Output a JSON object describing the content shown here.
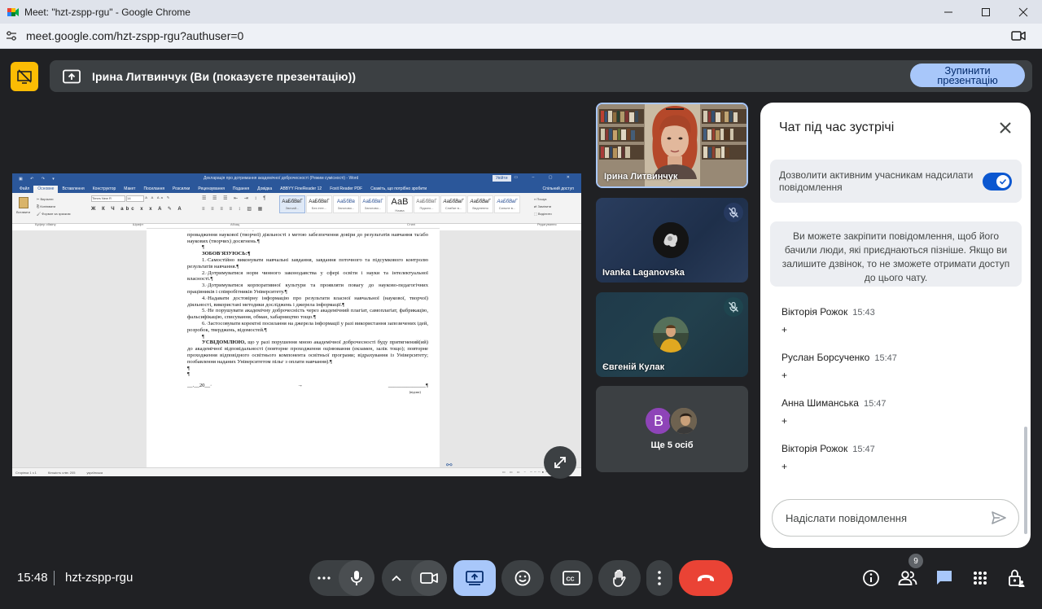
{
  "browser": {
    "window_title": "Meet: \"hzt-zspp-rgu\" - Google Chrome",
    "url": "meet.google.com/hzt-zspp-rgu?authuser=0"
  },
  "presenting": {
    "banner_text": "Ірина Литвинчук (Ви (показуєте презентацію))",
    "stop_button_label": "Зупинити презентацію"
  },
  "word": {
    "doc_title": "Декларація про дотримання академічної доброчесності (Режим сумісності) - Word",
    "sign_in": "Увійти",
    "tabs": [
      "Файл",
      "Основне",
      "Вставлення",
      "Конструктор",
      "Макет",
      "Посилання",
      "Розсилки",
      "Рецензування",
      "Подання",
      "Довідка",
      "ABBYY FineReader 12",
      "Foxit Reader PDF",
      "Скажіть, що потрібно зробити",
      "Спільний доступ"
    ],
    "active_tab": "Основне",
    "clipboard": {
      "paste": "Вставити",
      "cut": "Вирізати",
      "copy": "Копіювати",
      "format": "Формат за зразком"
    },
    "font_name": "Times New R",
    "font_size": "14",
    "styles": [
      {
        "sample": "АаБбВвГ",
        "name": "Звичай..."
      },
      {
        "sample": "АаБбВвГ",
        "name": "Без інте..."
      },
      {
        "sample": "АаБбВв",
        "name": "Заголово..."
      },
      {
        "sample": "АаБбВвГ",
        "name": "Заголово..."
      },
      {
        "sample": "АаВ",
        "name": "Назва"
      },
      {
        "sample": "АаБбВвГ",
        "name": "Підзаго..."
      },
      {
        "sample": "АаБбВвГ",
        "name": "Слабке в..."
      },
      {
        "sample": "АаБбВвГ",
        "name": "Виділення"
      },
      {
        "sample": "АаБбВвГ",
        "name": "Сильне в..."
      }
    ],
    "editing": {
      "find": "Пошук",
      "replace": "Замінити",
      "select": "Виділити"
    },
    "groups": {
      "clipboard": "Буфер обміну",
      "font": "Шрифт",
      "paragraph": "Абзац",
      "styles": "Стилі",
      "editing": "Редагування"
    },
    "body": {
      "p0": "цінностей академічної доброчесності та етики академічних взаємовідносин під час навчання та провадження наукової (творчої) діяльності з метою забезпечення довіри до результатів навчання та/або наукових (творчих) досягнень.¶",
      "p1": "¶",
      "h1": "ЗОБОВ'ЯЗУЮСЬ:¶",
      "p2": "1.·Самостійно виконувати навчальні завдання, завдання поточного та підсумкового контролю результатів навчання.¶",
      "p3": "2.·Дотримуватися норм чинного законодавства у сфері освіти і науки та інтелектуальної власності.¶",
      "p4": "3.·Дотримуватися корпоративної культури та проявляти повагу до науково-педагогічних працівників і співробітників Університету.¶",
      "p5": "4.·Надавати достовірну інформацію про результати власної навчальної (наукової, творчої) діяльності, використані методики досліджень і джерела інформації.¶",
      "p6": "5.·Не порушувати академічну доброчесність через академічний плагіат, самоплагіат, фабрикацію, фальсифікацію, списування, обман, хабарництво тощо.¶",
      "p7": "6.·Застосовувати коректні посилання на джерела інформації у разі використання запозичених ідей, розробок, тверджень, відомостей.¶",
      "p8": "¶",
      "h2": "УСВІДОМЛЮЮ,",
      "p9": " що у разі порушення мною академічної доброчесності буду притягнений(ий) до академічної відповідальності (повторне проходження оцінювання (екзамен, залік тощо); повторне проходження відповідного освітнього компонента освітньої програми; відрахування із Університету; позбавлення наданих Університетом пільг з оплати навчання).¶",
      "p10": "¶",
      "p11": "¶",
      "sig_left": "__.__20__·",
      "sig_mid": "→",
      "sig_right": "______________¶",
      "sig_caption": "(підпис)"
    },
    "status": {
      "page": "Сторінка 1 з 1",
      "words": "Кількість слів: 205",
      "lang": "українська"
    }
  },
  "participants": [
    {
      "name": "Ірина Литвинчук",
      "muted": false
    },
    {
      "name": "Ivanka Laganovska",
      "muted": true
    },
    {
      "name": "Євгеній Кулак",
      "muted": true
    }
  ],
  "more_tile": {
    "avatar_letter": "В",
    "label": "Ще 5 осіб"
  },
  "chat": {
    "title": "Чат під час зустрічі",
    "toggle_label": "Дозволити активним учасникам надсилати повідомлення",
    "toggle_on": true,
    "info": "Ви можете закріпити повідомлення, щоб його бачили люди, які приєднаються пізніше. Якщо ви залишите дзвінок, то не зможете отримати доступ до цього чату.",
    "messages": [
      {
        "sender": "Вікторія Рожок",
        "time": "15:43",
        "text": "+"
      },
      {
        "sender": "Руслан Борсученко",
        "time": "15:47",
        "text": "+"
      },
      {
        "sender": "Анна Шиманська",
        "time": "15:47",
        "text": "+"
      },
      {
        "sender": "Вікторія Рожок",
        "time": "15:47",
        "text": "+"
      }
    ],
    "input_placeholder": "Надіслати повідомлення"
  },
  "bottom_bar": {
    "time": "15:48",
    "meeting_code": "hzt-zspp-rgu",
    "participant_count": "9"
  },
  "colors": {
    "meet_bg": "#202124",
    "control_bg": "#3c4043",
    "accent_blue": "#a8c7fa",
    "hangup_red": "#ea4335",
    "present_yellow": "#fbbc04",
    "toggle_blue": "#0b57d0"
  }
}
